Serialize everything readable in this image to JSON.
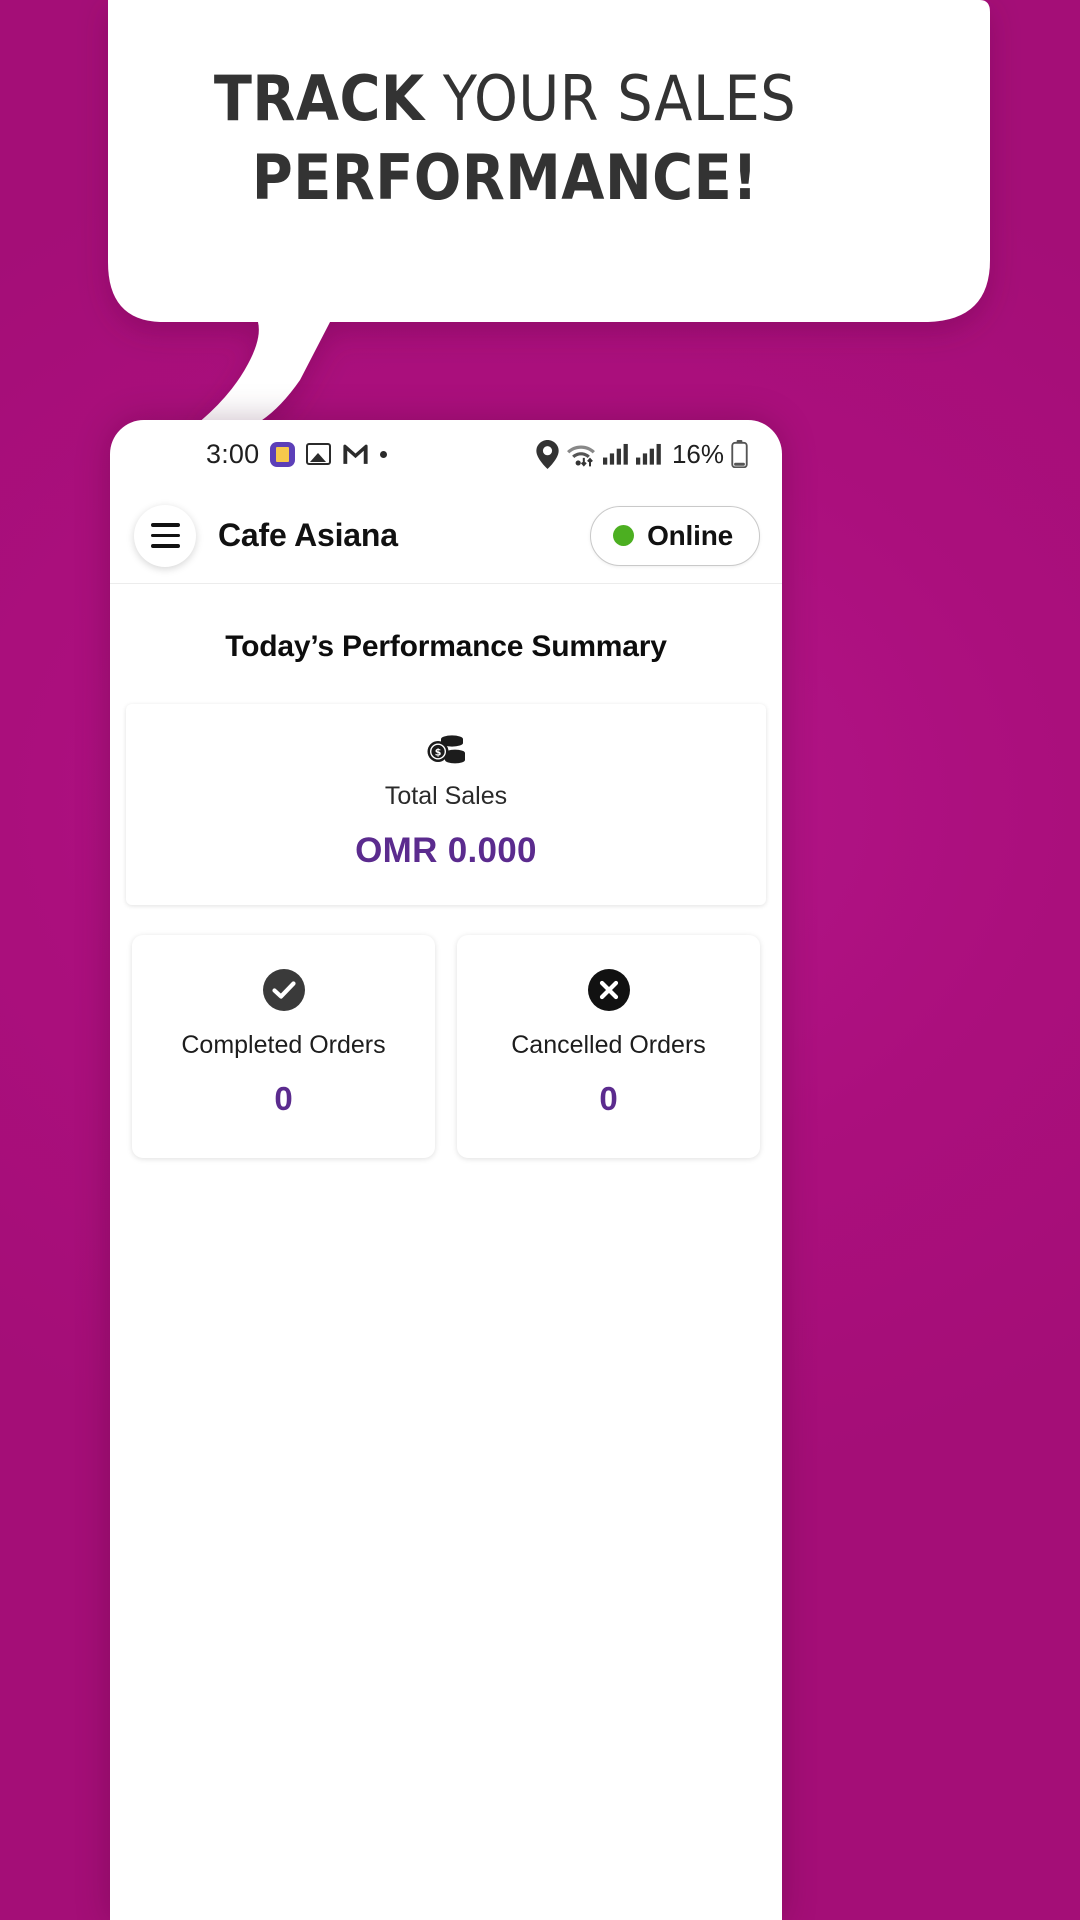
{
  "promo": {
    "headline_line1_strong": "TRACK",
    "headline_line1_rest": " YOUR SALES",
    "headline_line2": "PERFORMANCE!",
    "background_color": "#ad1180",
    "bubble_color": "#ffffff",
    "headline_color": "#333333"
  },
  "phone": {
    "status_bar": {
      "time": "3:00",
      "icons_left": [
        "app-badge-icon",
        "gallery-icon",
        "gmail-icon",
        "dot-icon"
      ],
      "icons_right": [
        "location-pin-icon",
        "wifi-icon",
        "signal-icon",
        "signal-icon"
      ],
      "battery_percent": "16%"
    },
    "app_bar": {
      "menu_icon": "hamburger-icon",
      "shop_name": "Cafe Asiana",
      "status": {
        "label": "Online",
        "dot_color": "#4caf21"
      }
    },
    "content": {
      "summary_title": "Today’s Performance Summary",
      "total_sales": {
        "icon": "coins-icon",
        "label": "Total Sales",
        "value": "OMR 0.000",
        "value_color": "#5b2b8e"
      },
      "orders": [
        {
          "icon": "check-circle-icon",
          "label": "Completed Orders",
          "value": "0",
          "value_color": "#5b2b8e"
        },
        {
          "icon": "x-circle-icon",
          "label": "Cancelled Orders",
          "value": "0",
          "value_color": "#5b2b8e"
        }
      ]
    }
  }
}
